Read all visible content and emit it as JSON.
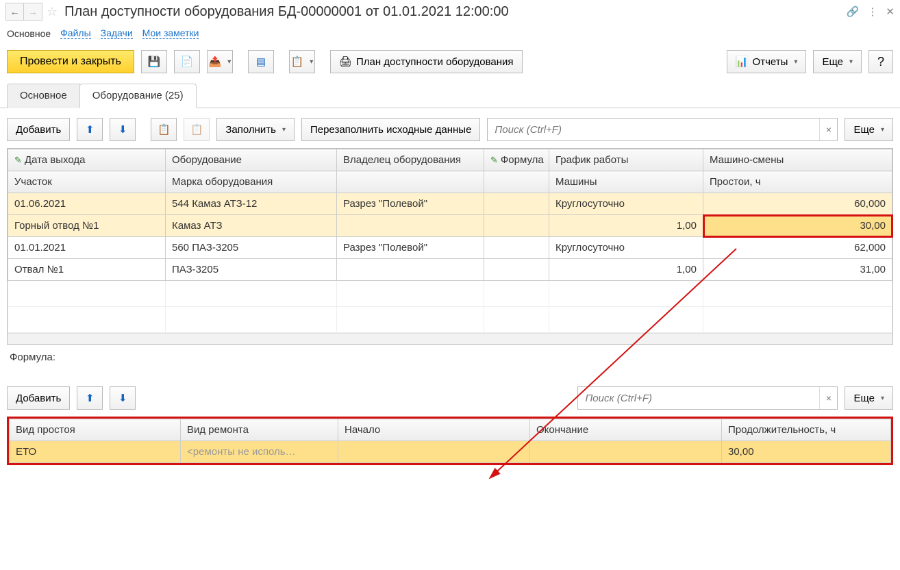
{
  "title": "План доступности оборудования БД-00000001 от 01.01.2021 12:00:00",
  "subnav": {
    "main": "Основное",
    "files": "Файлы",
    "tasks": "Задачи",
    "notes": "Мои заметки"
  },
  "toolbar": {
    "post_close": "Провести и закрыть",
    "plan_btn": "План доступности оборудования",
    "reports": "Отчеты",
    "more": "Еще",
    "q": "?"
  },
  "tabs": {
    "main": "Основное",
    "equip": "Оборудование (25)"
  },
  "equip_panel": {
    "add": "Добавить",
    "fill": "Заполнить",
    "refill": "Перезаполнить исходные данные",
    "search_ph": "Поиск (Ctrl+F)",
    "more": "Еще"
  },
  "headers1": {
    "date": "Дата выхода",
    "equip": "Оборудование",
    "owner": "Владелец оборудования",
    "formula": "Формула",
    "sched": "График работы",
    "shifts": "Машино-смены"
  },
  "headers2": {
    "site": "Участок",
    "brand": "Марка оборудования",
    "b1": "",
    "b2": "",
    "machines": "Машины",
    "idle": "Простои, ч"
  },
  "rows": [
    {
      "date": "01.06.2021",
      "equip": "544 Камаз АТЗ-12",
      "owner": "Разрез \"Полевой\"",
      "formula": "",
      "sched": "Круглосуточно",
      "shifts": "60,000",
      "site": "Горный отвод №1",
      "brand": "Камаз АТЗ",
      "machines": "1,00",
      "idle": "30,00",
      "selected": true
    },
    {
      "date": "01.01.2021",
      "equip": "560 ПАЗ-3205",
      "owner": "Разрез \"Полевой\"",
      "formula": "",
      "sched": "Круглосуточно",
      "shifts": "62,000",
      "site": "Отвал №1",
      "brand": "ПАЗ-3205",
      "machines": "1,00",
      "idle": "31,00",
      "selected": false
    }
  ],
  "formula_label": "Формула:",
  "detail_panel": {
    "add": "Добавить",
    "search_ph": "Поиск (Ctrl+F)",
    "more": "Еще"
  },
  "detail_headers": {
    "idle_kind": "Вид простоя",
    "repair_kind": "Вид ремонта",
    "start": "Начало",
    "end": "Окончание",
    "dur": "Продолжительность, ч"
  },
  "detail_row": {
    "idle_kind": "ЕТО",
    "repair_kind": "<ремонты не исполь…",
    "start": "",
    "end": "",
    "dur": "30,00"
  }
}
